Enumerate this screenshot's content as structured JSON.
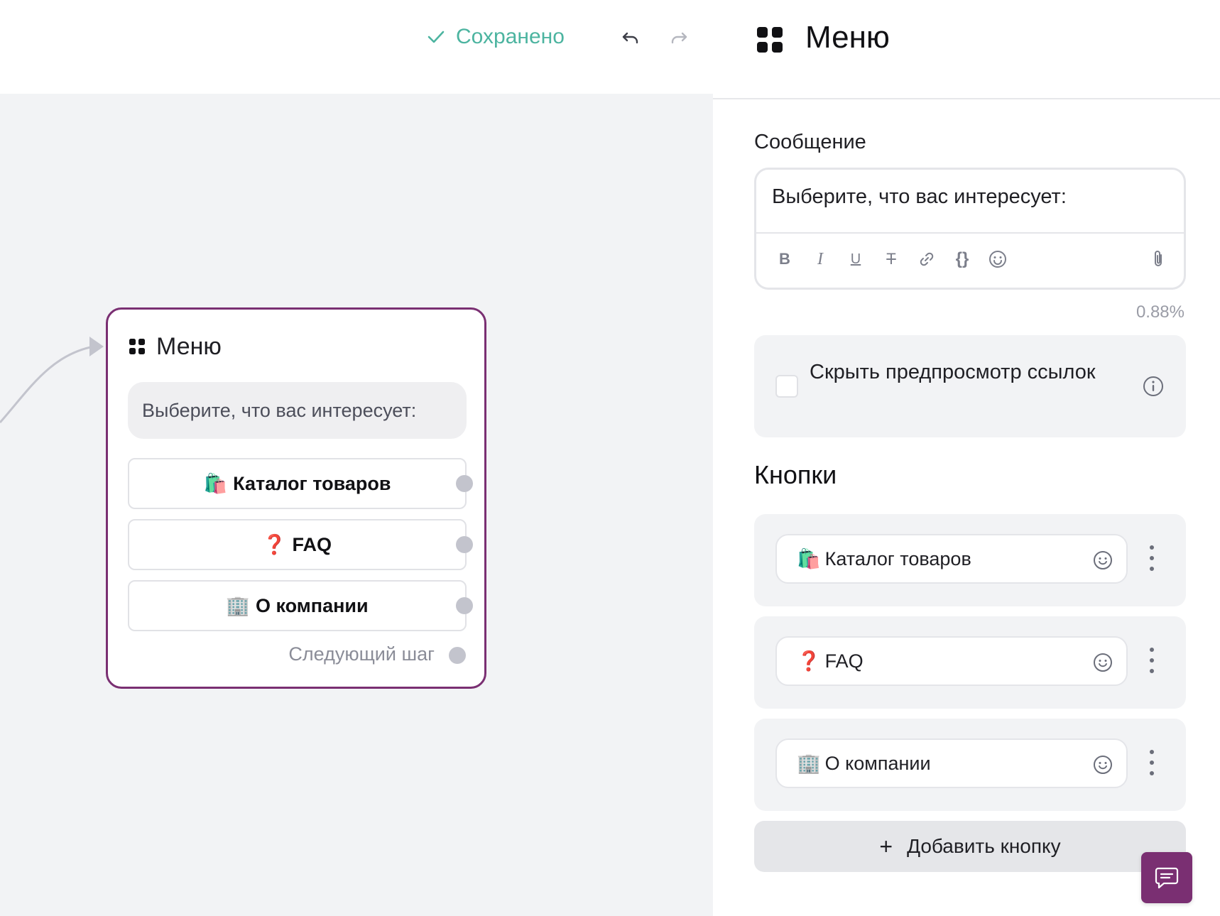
{
  "topbar": {
    "saved_status": "Сохранено",
    "undo_icon": "undo-icon",
    "redo_icon": "redo-icon"
  },
  "node": {
    "title": "Меню",
    "icon": "grid-icon",
    "message": "Выберите, что вас интересует:",
    "buttons": [
      {
        "emoji": "🛍️",
        "label": "Каталог товаров"
      },
      {
        "emoji": "❓",
        "label": "FAQ"
      },
      {
        "emoji": "🏢",
        "label": "О компании"
      }
    ],
    "next_step": "Следующий шаг"
  },
  "panel": {
    "title": "Меню",
    "message_label": "Сообщение",
    "message_text": "Выберите, что вас интересует:",
    "toolbar": {
      "bold": "B",
      "italic": "I",
      "underline": "U",
      "strike": "T",
      "code": "{}",
      "icons": [
        "link-icon",
        "emoji-icon",
        "attachment-icon"
      ]
    },
    "counter": "0.88%",
    "hide_preview_label": "Скрыть предпросмотр ссылок",
    "buttons_title": "Кнопки",
    "buttons": [
      {
        "emoji": "🛍️",
        "label": "Каталог товаров"
      },
      {
        "emoji": "❓",
        "label": "FAQ"
      },
      {
        "emoji": "🏢",
        "label": "О компании"
      }
    ],
    "add_button_plus": "+",
    "add_button": "Добавить кнопку"
  },
  "colors": {
    "accent": "#7a2f72",
    "saved": "#4cb4a0",
    "canvas_bg": "#f2f3f5",
    "port": "#c3c4cd"
  }
}
